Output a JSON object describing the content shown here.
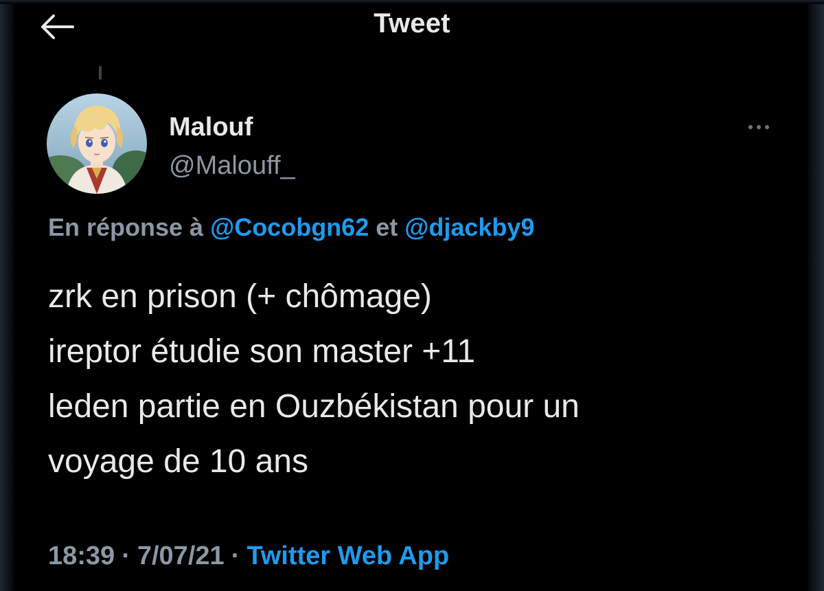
{
  "header": {
    "title": "Tweet",
    "back_icon": "arrow-left-icon"
  },
  "tweet": {
    "author": {
      "name": "Malouf",
      "handle": "@Malouff_",
      "avatar_icon": "anime-avatar"
    },
    "more_icon": "more-horizontal-icon",
    "reply": {
      "prefix": "En réponse à",
      "mention_1": "@Cocobgn62",
      "connector": "et",
      "mention_2": "@djackby9"
    },
    "text_lines": [
      "zrk en prison (+ chômage)",
      "ireptor étudie son master +11",
      "leden partie en Ouzbékistan pour un",
      "voyage de 10 ans"
    ],
    "meta": {
      "time": "18:39",
      "separator": "·",
      "date": "7/07/21",
      "source": "Twitter Web App"
    }
  },
  "colors": {
    "background": "#000000",
    "text": "#e7e9ea",
    "secondary": "#8b98a5",
    "accent": "#1d9bf0"
  }
}
